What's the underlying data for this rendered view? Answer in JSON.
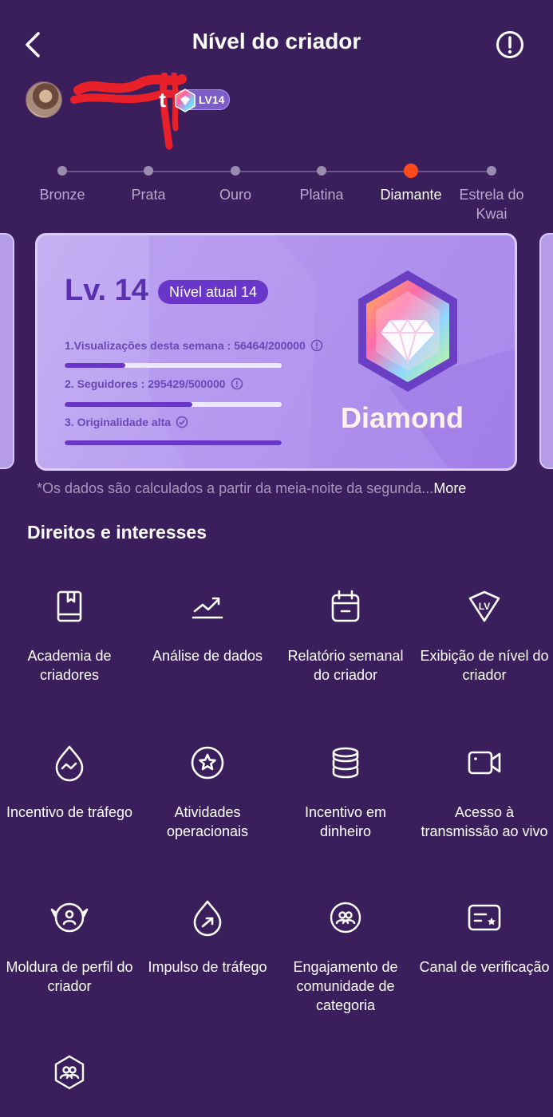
{
  "header": {
    "title": "Nível do criador"
  },
  "profile": {
    "name_suffix": "t",
    "badge": "LV14"
  },
  "levels": [
    {
      "label": "Bronze",
      "active": false
    },
    {
      "label": "Prata",
      "active": false
    },
    {
      "label": "Ouro",
      "active": false
    },
    {
      "label": "Platina",
      "active": false
    },
    {
      "label": "Diamante",
      "active": true
    },
    {
      "label": "Estrela do Kwai",
      "active": false
    }
  ],
  "card": {
    "level": "Lv. 14",
    "current_pill": "Nível atual 14",
    "requirements": [
      {
        "text": "1.Visualizações desta semana : 56464/200000",
        "progress": 0.28
      },
      {
        "text": "2. Seguidores : 295429/500000",
        "progress": 0.59
      },
      {
        "text": "3. Originalidade alta",
        "progress": 1.0
      }
    ],
    "tier_name": "Diamond"
  },
  "note": {
    "text": "*Os dados são calculados a partir da meia-noite da segunda...",
    "more": "More"
  },
  "section_title": "Direitos e interesses",
  "benefits": [
    {
      "label": "Academia de criadores",
      "icon": "book-icon"
    },
    {
      "label": "Análise de dados",
      "icon": "trend-chart-icon"
    },
    {
      "label": "Relatório semanal do criador",
      "icon": "calendar-icon"
    },
    {
      "label": "Exibição de nível do criador",
      "icon": "lv-shield-icon"
    },
    {
      "label": "Incentivo de tráfego",
      "icon": "drop-wave-icon"
    },
    {
      "label": "Atividades operacionais",
      "icon": "star-circle-icon"
    },
    {
      "label": "Incentivo em dinheiro",
      "icon": "coin-stack-icon"
    },
    {
      "label": "Acesso à transmissão ao vivo",
      "icon": "video-camera-icon"
    },
    {
      "label": "Moldura de perfil do criador",
      "icon": "profile-frame-icon"
    },
    {
      "label": "Impulso de tráfego",
      "icon": "drop-arrow-icon"
    },
    {
      "label": "Engajamento de comunidade de categoria",
      "icon": "community-icon"
    },
    {
      "label": "Canal de verificação",
      "icon": "verify-card-icon"
    },
    {
      "label": "",
      "icon": "group-hex-icon"
    }
  ],
  "colors": {
    "background": "#3b1f5c",
    "accent": "#6a36c9",
    "active_dot": "#ff4a1c"
  }
}
